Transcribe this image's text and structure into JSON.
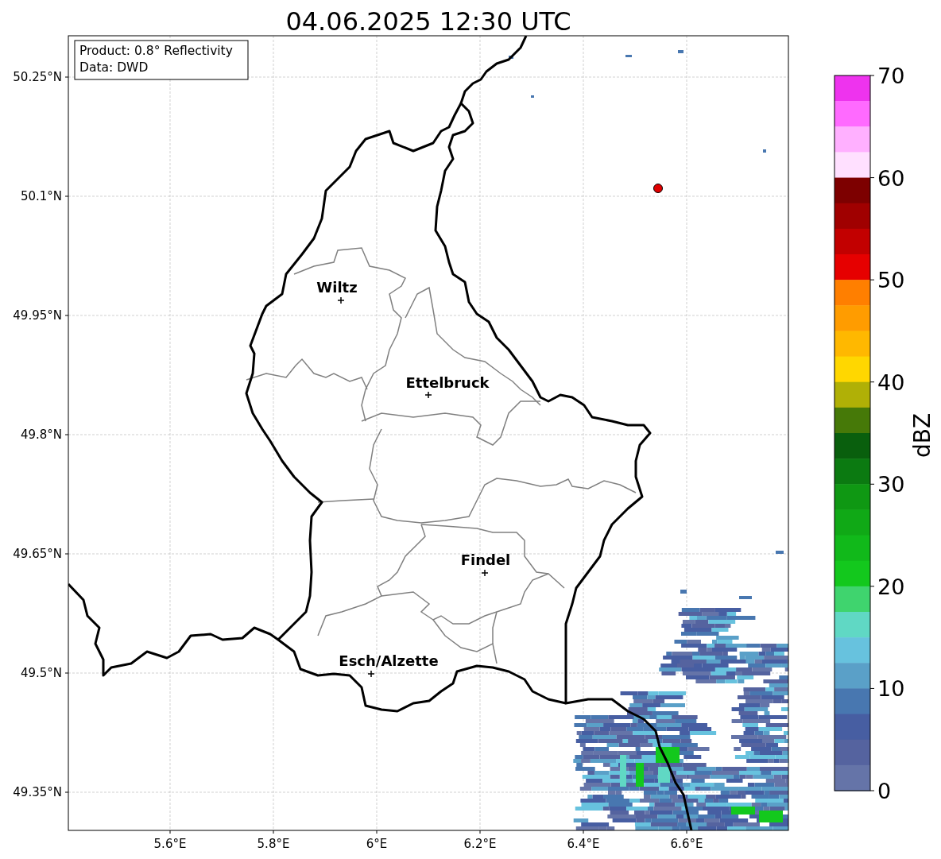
{
  "title": "04.06.2025 12:30 UTC",
  "info_box": {
    "lines": [
      "Product: 0.8° Reflectivity",
      "Data: DWD"
    ]
  },
  "cities": [
    {
      "name": "Wiltz"
    },
    {
      "name": "Ettelbruck"
    },
    {
      "name": "Findel"
    },
    {
      "name": "Esch/Alzette"
    }
  ],
  "lat_ticks": [
    "50.25°N",
    "50.1°N",
    "49.95°N",
    "49.8°N",
    "49.65°N",
    "49.5°N",
    "49.35°N"
  ],
  "lon_ticks": [
    "5.6°E",
    "5.8°E",
    "6°E",
    "6.2°E",
    "6.4°E",
    "6.6°E"
  ],
  "colorbar": {
    "label": "dBZ",
    "ticks": [
      "70",
      "60",
      "50",
      "40",
      "30",
      "20",
      "10",
      "0"
    ],
    "bands": [
      {
        "color": "#ee33ee"
      },
      {
        "color": "#ff6aff"
      },
      {
        "color": "#ffb0ff"
      },
      {
        "color": "#ffe0ff"
      },
      {
        "color": "#7d0000"
      },
      {
        "color": "#a00000"
      },
      {
        "color": "#c20000"
      },
      {
        "color": "#e60000"
      },
      {
        "color": "#ff7f00"
      },
      {
        "color": "#ff9c00"
      },
      {
        "color": "#ffb800"
      },
      {
        "color": "#ffd700"
      },
      {
        "color": "#b0b006"
      },
      {
        "color": "#467908"
      },
      {
        "color": "#095f0d"
      },
      {
        "color": "#0b7a11"
      },
      {
        "color": "#0f9813"
      },
      {
        "color": "#10a916"
      },
      {
        "color": "#11b91a"
      },
      {
        "color": "#13c81d"
      },
      {
        "color": "#3fd46e"
      },
      {
        "color": "#60d8c4"
      },
      {
        "color": "#67c2de"
      },
      {
        "color": "#5aa0c8"
      },
      {
        "color": "#4877b0"
      },
      {
        "color": "#475ea2"
      },
      {
        "color": "#55639f"
      },
      {
        "color": "#6574a8"
      }
    ]
  }
}
